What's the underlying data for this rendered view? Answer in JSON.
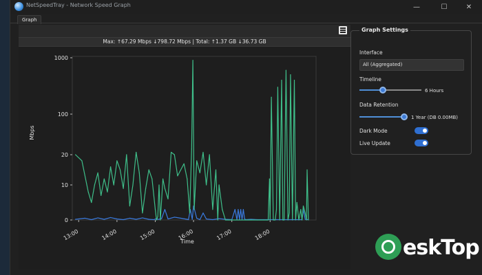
{
  "window": {
    "title": "NetSpeedTray - Network Speed Graph",
    "controls": {
      "minimize": "—",
      "maximize": "☐",
      "close": "✕"
    }
  },
  "tabs": [
    {
      "label": "Graph"
    }
  ],
  "graph": {
    "stats": "Max: ↑67.29 Mbps ↓798.72 Mbps | Total: ↑1.37 GB ↓36.73 GB"
  },
  "settings": {
    "title": "Graph Settings",
    "interface_label": "Interface",
    "interface_value": "All (Aggregated)",
    "timeline_label": "Timeline",
    "timeline_value": "6 Hours",
    "timeline_level": 0.38,
    "retention_label": "Data Retention",
    "retention_value": "1 Year (DB 0.00MB)",
    "retention_level": 1.0,
    "dark_mode_label": "Dark Mode",
    "dark_mode_on": true,
    "live_update_label": "Live Update",
    "live_update_on": true
  },
  "watermark": {
    "text": "eskTop"
  },
  "colors": {
    "download": "#3fbf8a",
    "upload": "#3a7be0",
    "accent": "#2f6fd1"
  },
  "chart_data": {
    "type": "line",
    "xlabel": "Time",
    "ylabel": "Mbps",
    "x_ticks": [
      "13:00",
      "14:00",
      "15:00",
      "16:00",
      "17:00",
      "18:00"
    ],
    "y_ticks": [
      "0",
      "10",
      "20",
      "100",
      "1000"
    ],
    "y_scale": "symlog",
    "grid": false,
    "series": [
      {
        "color": "#3fbf8a",
        "x": [
          "12:55",
          "13:05",
          "13:15",
          "13:20",
          "13:25",
          "13:30",
          "13:35",
          "13:40",
          "13:45",
          "13:50",
          "13:55",
          "14:00",
          "14:05",
          "14:10",
          "14:15",
          "14:20",
          "14:25",
          "14:30",
          "14:35",
          "14:40",
          "14:45",
          "14:50",
          "14:55",
          "15:00",
          "15:02",
          "15:04",
          "15:06",
          "15:08",
          "15:12",
          "15:15",
          "15:20",
          "15:25",
          "15:30",
          "15:35",
          "15:40",
          "15:45",
          "15:50",
          "15:54",
          "15:57",
          "15:59",
          "16:01",
          "16:05",
          "16:10",
          "16:15",
          "16:20",
          "16:25",
          "16:30",
          "16:35",
          "16:38",
          "16:40",
          "16:45",
          "16:50",
          "16:55",
          "17:00",
          "17:05",
          "17:10",
          "17:20",
          "17:30",
          "17:40",
          "17:50",
          "17:55",
          "17:57",
          "17:59",
          "18:00",
          "18:02",
          "18:05",
          "18:08",
          "18:10",
          "18:12",
          "18:15",
          "18:18",
          "18:20",
          "18:22",
          "18:25",
          "18:28",
          "18:30",
          "18:32",
          "18:35",
          "18:38",
          "18:40",
          "18:42",
          "18:45",
          "18:48",
          "18:50",
          "18:52",
          "18:55",
          "18:57",
          "18:58",
          "19:00"
        ],
        "y": [
          20,
          18,
          8,
          5,
          10,
          14,
          7,
          12,
          8,
          16,
          10,
          18,
          15,
          9,
          20,
          4,
          10,
          22,
          14,
          2,
          9,
          15,
          12,
          3,
          0,
          1,
          10,
          0,
          12,
          9,
          6,
          22,
          20,
          13,
          15,
          17,
          12,
          2,
          25,
          900,
          3,
          18,
          14,
          22,
          10,
          20,
          3,
          15,
          0,
          10,
          3,
          0,
          0,
          0,
          0,
          0,
          0,
          0,
          0,
          0,
          0,
          0,
          12,
          0,
          200,
          0,
          0,
          3,
          300,
          0,
          400,
          0,
          0,
          600,
          0,
          2,
          500,
          0,
          400,
          0,
          5,
          0,
          3,
          0,
          4,
          2,
          0,
          15,
          0
        ]
      },
      {
        "color": "#3a7be0",
        "x": [
          "12:55",
          "13:10",
          "13:20",
          "13:30",
          "13:40",
          "13:50",
          "14:00",
          "14:10",
          "14:20",
          "14:30",
          "14:40",
          "14:50",
          "14:58",
          "15:00",
          "15:05",
          "15:10",
          "15:15",
          "15:20",
          "15:30",
          "15:40",
          "15:50",
          "15:52",
          "15:55",
          "15:58",
          "16:00",
          "16:05",
          "16:10",
          "16:15",
          "16:20",
          "16:30",
          "16:40",
          "16:50",
          "17:00",
          "17:05",
          "17:08",
          "17:10",
          "17:12",
          "17:14",
          "17:16",
          "17:18",
          "17:20",
          "17:22",
          "17:30",
          "17:40",
          "17:50",
          "18:00",
          "18:10",
          "18:20",
          "18:30",
          "18:40",
          "18:50",
          "18:52",
          "18:55",
          "19:00"
        ],
        "y": [
          0.2,
          0.5,
          0.1,
          0.6,
          0.2,
          0.7,
          0.3,
          0.1,
          0.5,
          0.2,
          0.6,
          0.2,
          0.1,
          0.3,
          0.2,
          0.4,
          3,
          0.3,
          0.8,
          0.5,
          0.2,
          0.1,
          3,
          0.2,
          4,
          0.5,
          0.1,
          2,
          0.3,
          0.1,
          0.4,
          0.2,
          0.1,
          3,
          0.1,
          3,
          0.2,
          3,
          0.1,
          3,
          0.3,
          0.1,
          0.2,
          0.1,
          0.1,
          0.1,
          0.1,
          0.1,
          0.1,
          0.1,
          0.1,
          3,
          0.2,
          0.1
        ]
      }
    ]
  }
}
